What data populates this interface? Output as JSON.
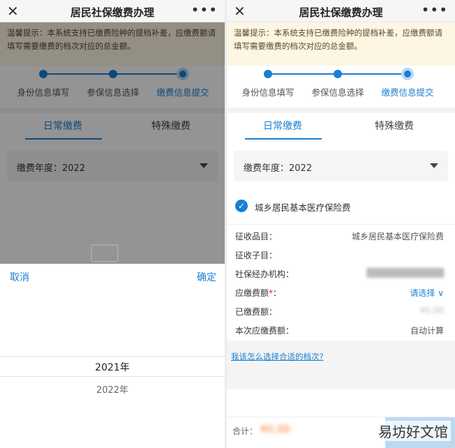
{
  "left": {
    "topbar": {
      "title": "居民社保缴费办理",
      "close_glyph": "✕",
      "more_glyph": "•••"
    },
    "tip": "温馨提示：本系统支持已缴费险种的提档补差，应缴费额请填写需要缴费的档次对应的总金额。",
    "steps": [
      "身份信息填写",
      "参保信息选择",
      "缴费信息提交"
    ],
    "tabs": [
      "日常缴费",
      "特殊缴费"
    ],
    "year_label": "缴费年度：2022",
    "picker": {
      "cancel": "取消",
      "confirm": "确定",
      "options": [
        "2021年",
        "2022年"
      ]
    }
  },
  "right": {
    "topbar": {
      "title": "居民社保缴费办理",
      "close_glyph": "✕",
      "more_glyph": "•••"
    },
    "tip": "温馨提示：本系统支持已缴费险种的提档补差，应缴费额请填写需要缴费的档次对应的总金额。",
    "steps": [
      "身份信息填写",
      "参保信息选择",
      "缴费信息提交"
    ],
    "tabs": [
      "日常缴费",
      "特殊缴费"
    ],
    "year_label": "缴费年度：2022",
    "insurance": {
      "label": "城乡居民基本医疗保险费",
      "checked": true
    },
    "rows": [
      {
        "key": "征收品目：",
        "value": "城乡居民基本医疗保险费"
      },
      {
        "key": "征收子目：",
        "value": ""
      },
      {
        "key": "社保经办机构：",
        "value": "████████████"
      },
      {
        "key": "应缴费额",
        "required": "*",
        "suffix": "：",
        "value": "请选择 ∨"
      },
      {
        "key": "已缴费额：",
        "value": "¥0.00"
      },
      {
        "key": "本次应缴费额：",
        "value": "自动计算"
      }
    ],
    "help_link": "我该怎么选择合适的档次?",
    "footer": {
      "total_label": "合计：",
      "total_value": "¥0.00"
    },
    "watermark": "易坊好文馆"
  },
  "colors": {
    "accent": "#1a7fd0",
    "tip_bg": "#fdf6e3",
    "total": "#ff7a2a"
  }
}
